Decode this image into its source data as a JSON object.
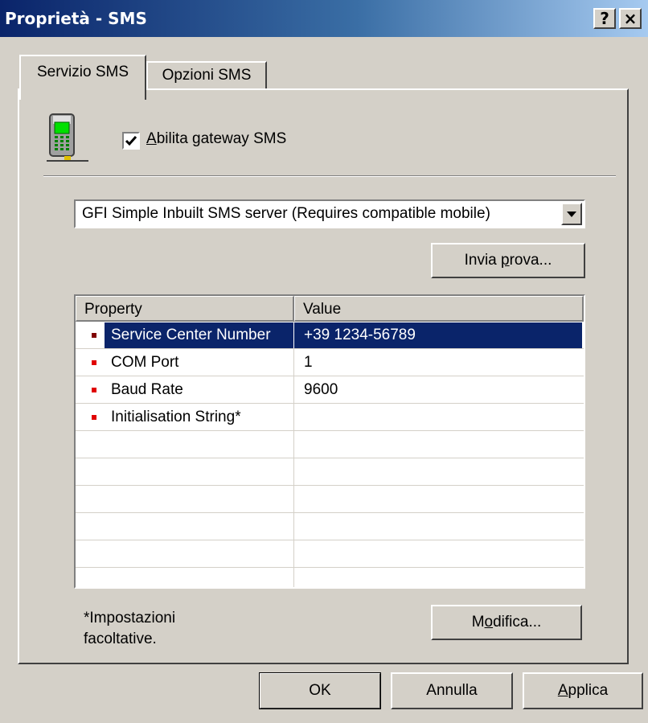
{
  "window": {
    "title": "Proprietà - SMS",
    "help_label": "?",
    "close_label": "×"
  },
  "tabs": [
    {
      "label": "Servizio SMS",
      "active": true
    },
    {
      "label": "Opzioni SMS",
      "active": false
    }
  ],
  "gateway": {
    "icon": "mobile-phone-icon",
    "checkbox_checked": true,
    "checkbox_label_hotkey": "A",
    "checkbox_label_rest": "bilita gateway SMS"
  },
  "server_select": {
    "selected": "GFI Simple Inbuilt SMS server (Requires compatible mobile)"
  },
  "buttons": {
    "test_pre": "Invia ",
    "test_hotkey": "p",
    "test_post": "rova...",
    "modify_pre": "M",
    "modify_hotkey": "o",
    "modify_post": "difica...",
    "ok": "OK",
    "cancel": "Annulla",
    "apply_hotkey": "A",
    "apply_rest": "pplica"
  },
  "table": {
    "columns": [
      "Property",
      "Value"
    ],
    "rows": [
      {
        "property": "Service Center Number",
        "value": "+39 1234-56789",
        "selected": true
      },
      {
        "property": "COM Port",
        "value": "1",
        "selected": false
      },
      {
        "property": "Baud Rate",
        "value": "9600",
        "selected": false
      },
      {
        "property": "Initialisation String*",
        "value": "",
        "selected": false
      }
    ]
  },
  "note": {
    "line1": "*Impostazioni",
    "line2": "facoltative."
  },
  "colors": {
    "title_start": "#0a246a",
    "title_end": "#a6caf0",
    "selection": "#0a246a",
    "bullet": "#e00000",
    "face": "#d4d0c8"
  }
}
